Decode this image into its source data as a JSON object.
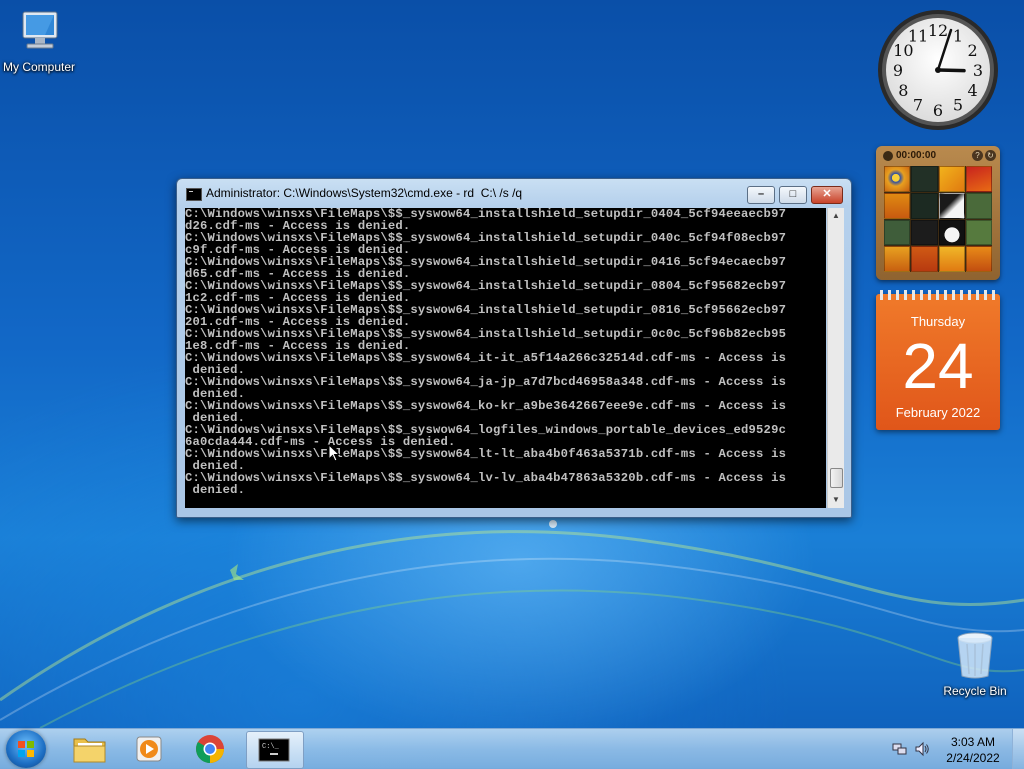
{
  "desktop": {
    "icons": [
      {
        "label": "My Computer",
        "icon": "computer-icon"
      },
      {
        "label": "Recycle Bin",
        "icon": "recycle-bin-icon"
      }
    ]
  },
  "cmd_window": {
    "title": "Administrator: C:\\Windows\\System32\\cmd.exe - rd  C:\\ /s /q",
    "buttons": {
      "minimize": "–",
      "maximize": "□",
      "close": "✕"
    },
    "lines": [
      "C:\\Windows\\winsxs\\FileMaps\\$$_syswow64_installshield_setupdir_0404_5cf94eeaecb97",
      "d26.cdf-ms - Access is denied.",
      "C:\\Windows\\winsxs\\FileMaps\\$$_syswow64_installshield_setupdir_040c_5cf94f08ecb97",
      "c9f.cdf-ms - Access is denied.",
      "C:\\Windows\\winsxs\\FileMaps\\$$_syswow64_installshield_setupdir_0416_5cf94ecaecb97",
      "d65.cdf-ms - Access is denied.",
      "C:\\Windows\\winsxs\\FileMaps\\$$_syswow64_installshield_setupdir_0804_5cf95682ecb97",
      "1c2.cdf-ms - Access is denied.",
      "C:\\Windows\\winsxs\\FileMaps\\$$_syswow64_installshield_setupdir_0816_5cf95662ecb97",
      "201.cdf-ms - Access is denied.",
      "C:\\Windows\\winsxs\\FileMaps\\$$_syswow64_installshield_setupdir_0c0c_5cf96b82ecb95",
      "1e8.cdf-ms - Access is denied.",
      "C:\\Windows\\winsxs\\FileMaps\\$$_syswow64_it-it_a5f14a266c32514d.cdf-ms - Access is",
      " denied.",
      "C:\\Windows\\winsxs\\FileMaps\\$$_syswow64_ja-jp_a7d7bcd46958a348.cdf-ms - Access is",
      " denied.",
      "C:\\Windows\\winsxs\\FileMaps\\$$_syswow64_ko-kr_a9be3642667eee9e.cdf-ms - Access is",
      " denied.",
      "C:\\Windows\\winsxs\\FileMaps\\$$_syswow64_logfiles_windows_portable_devices_ed9529c",
      "6a0cda444.cdf-ms - Access is denied.",
      "C:\\Windows\\winsxs\\FileMaps\\$$_syswow64_lt-lt_aba4b0f463a5371b.cdf-ms - Access is",
      " denied.",
      "C:\\Windows\\winsxs\\FileMaps\\$$_syswow64_lv-lv_aba4b47863a5320b.cdf-ms - Access is",
      " denied."
    ]
  },
  "gadgets": {
    "clock": {
      "numbers": [
        "12",
        "1",
        "2",
        "3",
        "4",
        "5",
        "6",
        "7",
        "8",
        "9",
        "10",
        "11"
      ],
      "hour": 3,
      "minute": 3
    },
    "puzzle": {
      "timer": "00:00:00",
      "help": "?",
      "shuffle": "↻"
    },
    "calendar": {
      "weekday": "Thursday",
      "day": "24",
      "month_year": "February 2022"
    }
  },
  "taskbar": {
    "pinned": [
      {
        "name": "explorer",
        "icon": "folder-icon"
      },
      {
        "name": "media-player",
        "icon": "media-player-icon"
      },
      {
        "name": "chrome",
        "icon": "chrome-icon"
      },
      {
        "name": "cmd",
        "icon": "cmd-icon",
        "active": true
      }
    ],
    "tray": {
      "time": "3:03 AM",
      "date": "2/24/2022"
    }
  },
  "colors": {
    "accent_orange": "#e8611e",
    "console_text": "#c0c0c0",
    "console_bg": "#000000"
  }
}
